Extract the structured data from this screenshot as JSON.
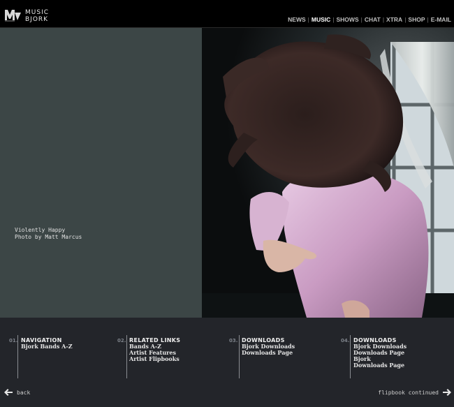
{
  "header": {
    "logo_alt": "MTV",
    "section": "MUSIC",
    "artist": "BJORK",
    "nav": [
      {
        "label": "NEWS",
        "active": false
      },
      {
        "label": "MUSIC",
        "active": true
      },
      {
        "label": "SHOWS",
        "active": false
      },
      {
        "label": "CHAT",
        "active": false
      },
      {
        "label": "XTRA",
        "active": false
      },
      {
        "label": "SHOP",
        "active": false
      },
      {
        "label": "E-MAIL",
        "active": false
      }
    ],
    "separator": "|"
  },
  "caption": {
    "title": "Violently Happy",
    "credit": "Photo by Matt Marcus"
  },
  "bottom": {
    "columns": [
      {
        "number": "01.",
        "heading": "NAVIGATION",
        "links": [
          "Bjork Bands A-Z"
        ]
      },
      {
        "number": "02.",
        "heading": "RELATED LINKS",
        "links": [
          "Bands A-Z",
          "Artist Features",
          "Artist Flipbooks"
        ]
      },
      {
        "number": "03.",
        "heading": "DOWNLOADS",
        "links": [
          "Bjork Downloads",
          "Downloads Page"
        ]
      },
      {
        "number": "04.",
        "heading": "DOWNLOADS",
        "links": [
          "Bjork Downloads",
          "Downloads Page",
          "Bjork",
          "Downloads Page"
        ]
      }
    ],
    "back_label": "back",
    "next_label": "flipbook continued"
  },
  "colors": {
    "left_panel": "#3c4646",
    "bottom_bar": "#23252a",
    "header": "#000000"
  }
}
